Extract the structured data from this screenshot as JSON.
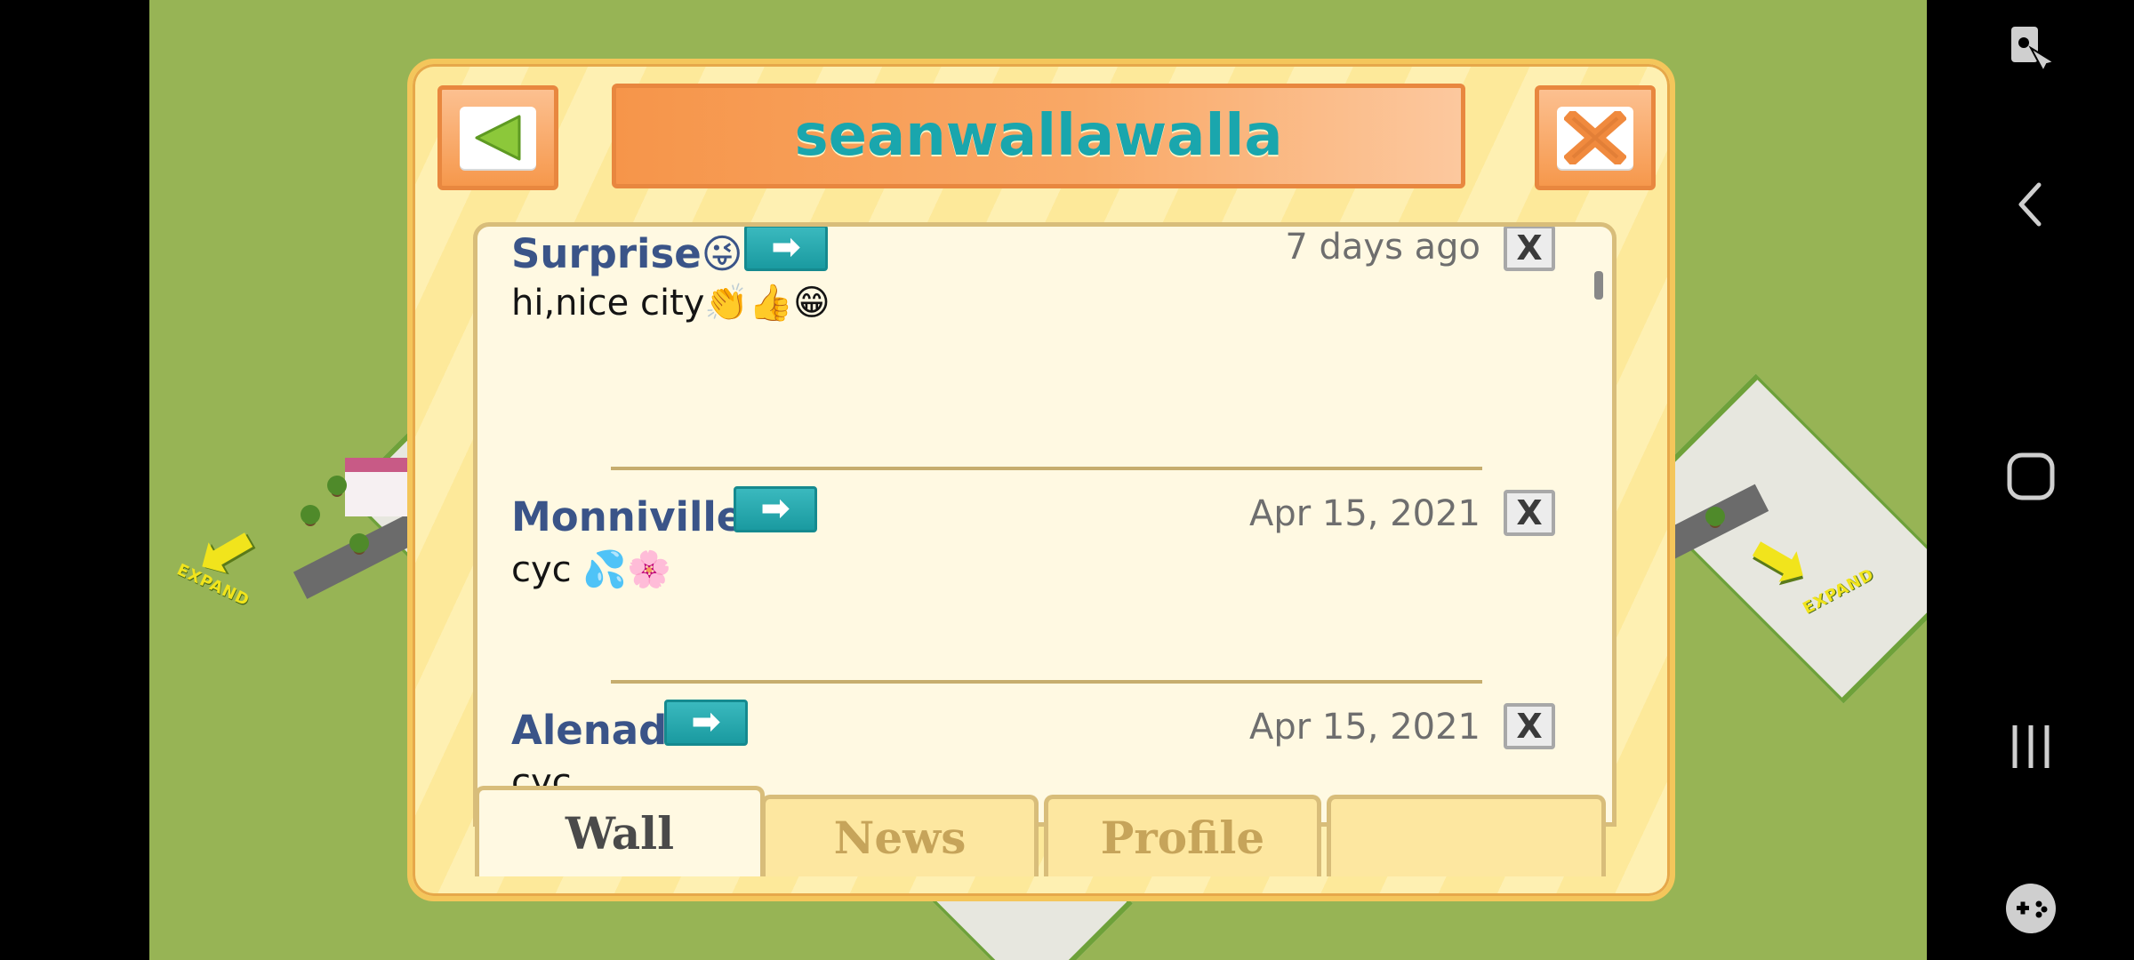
{
  "dialog": {
    "title": "seanwallawalla"
  },
  "posts": [
    {
      "author": "Surprise😜",
      "date": "7 days ago",
      "text": "hi,nice city👏👍😁",
      "delete_label": "X",
      "go_label": "➡"
    },
    {
      "author": "Monniville",
      "date": "Apr 15, 2021",
      "text": "cyc 💦🌸",
      "delete_label": "X",
      "go_label": "➡"
    },
    {
      "author": "Alenad",
      "date": "Apr 15, 2021",
      "text": "cyc",
      "delete_label": "X",
      "go_label": "➡"
    }
  ],
  "tabs": [
    {
      "label": "Wall",
      "active": true
    },
    {
      "label": "News",
      "active": false
    },
    {
      "label": "Profile",
      "active": false
    },
    {
      "label": "",
      "active": false
    }
  ],
  "game": {
    "expand_left": "EXPAND",
    "expand_right": "EXPAND"
  },
  "colors": {
    "title": "#1aa6ad",
    "author": "#3a5488",
    "go_button": "#1aa6ad",
    "dialog_bg": "#fde99a"
  },
  "icons": {
    "back": "back-triangle-icon",
    "close": "close-x-icon",
    "go": "arrow-right-icon",
    "delete": "delete-x-icon",
    "nav": [
      "screen-lock-icon",
      "back-chevron-icon",
      "home-square-icon",
      "recents-bars-icon",
      "game-controller-icon"
    ]
  }
}
